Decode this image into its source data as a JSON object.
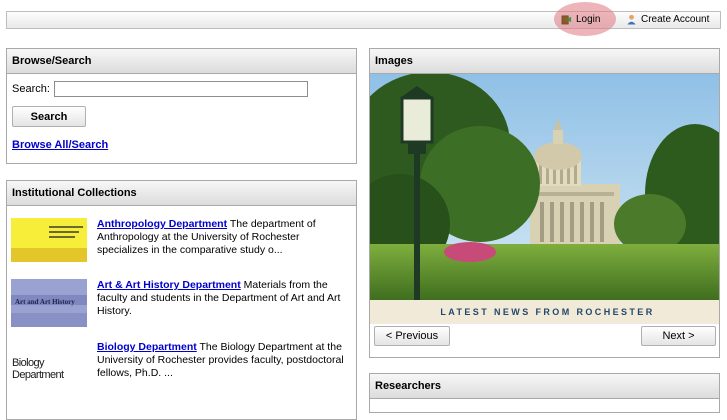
{
  "topbar": {
    "login_label": "Login",
    "create_account_label": "Create Account",
    "highlight_color": "#de7882"
  },
  "browse": {
    "title": "Browse/Search",
    "search_label": "Search:",
    "search_value": "",
    "search_button": "Search",
    "browse_all_link": "Browse All/Search"
  },
  "collections": {
    "title": "Institutional Collections",
    "items": [
      {
        "name": "Anthropology Department",
        "description": " The department of Anthropology at the University of Rochester specializes in the comparative study o..."
      },
      {
        "name": "Art & Art History Department",
        "description": " Materials from the faculty and students in the Department of Art and Art History.",
        "thumb_text": "Art and Art History"
      },
      {
        "name": "Biology Department",
        "description": " The Biology Department at the University of Rochester provides faculty, postdoctoral fellows, Ph.D. ...",
        "thumb_text": "Biology Department"
      }
    ]
  },
  "images": {
    "title": "Images",
    "banner_text": "LATEST NEWS FROM ROCHESTER",
    "prev_button": "< Previous",
    "next_button": "Next >"
  },
  "researchers": {
    "title": "Researchers"
  },
  "colors": {
    "link": "#0000cc",
    "panel_border": "#a9a9a9",
    "banner_text": "#24476b"
  }
}
